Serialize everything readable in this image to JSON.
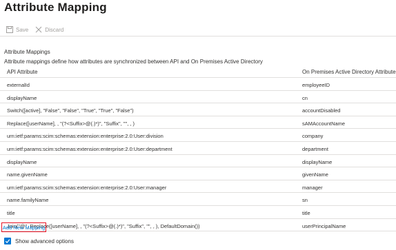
{
  "header": {
    "title": "Attribute Mapping",
    "more": "···"
  },
  "toolbar": {
    "save_label": "Save",
    "discard_label": "Discard"
  },
  "section": {
    "title": "Attribute Mappings",
    "description": "Attribute mappings define how attributes are synchronized between API and On Premises Active Directory"
  },
  "table": {
    "headers": [
      "API Attribute",
      "On Premises Active Directory Attribute"
    ],
    "rows": [
      [
        "externalId",
        "employeeID"
      ],
      [
        "displayName",
        "cn"
      ],
      [
        "Switch([active], \"False\", \"False\", \"True\", \"True\", \"False\")",
        "accountDisabled"
      ],
      [
        "Replace([userName], , \"(?<Suffix>@(.)*)\", \"Suffix\", \"\", , )",
        "sAMAccountName"
      ],
      [
        "urn:ietf:params:scim:schemas:extension:enterprise:2.0:User:division",
        "company"
      ],
      [
        "urn:ietf:params:scim:schemas:extension:enterprise:2.0:User:department",
        "department"
      ],
      [
        "displayName",
        "displayName"
      ],
      [
        "name.givenName",
        "givenName"
      ],
      [
        "urn:ietf:params:scim:schemas:extension:enterprise:2.0:User:manager",
        "manager"
      ],
      [
        "name.familyName",
        "sn"
      ],
      [
        "title",
        "title"
      ],
      [
        "Join(\"@\", Replace([userName], , \"(?<Suffix>@(.)*)\", \"Suffix\", \"\", , ), DefaultDomain())",
        "userPrincipalName"
      ]
    ]
  },
  "add_mapping_label": "Add New Mapping",
  "advanced": {
    "label": "Show advanced options",
    "checked": true
  },
  "colors": {
    "accent": "#0078d4",
    "highlight_border": "#e81123"
  }
}
